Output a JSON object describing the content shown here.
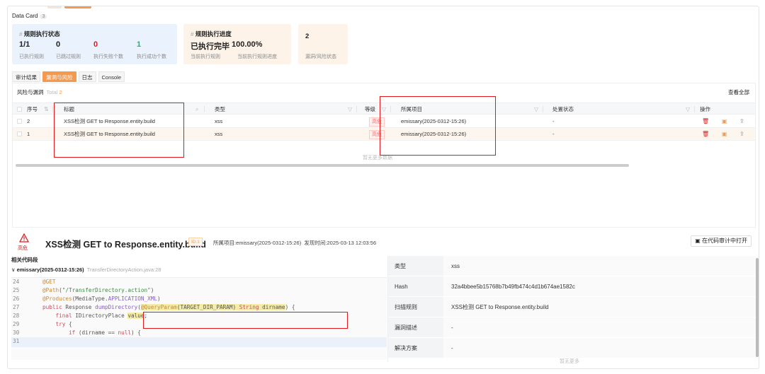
{
  "data_card": {
    "title": "Data Card",
    "count": "3",
    "cards": [
      {
        "title": "规则执行状态",
        "hash": "#",
        "values": [
          {
            "value": "1/1",
            "label": "已执行规则",
            "color": "#222222"
          },
          {
            "value": "0",
            "label": "已跳过规则",
            "color": "#222222"
          },
          {
            "value": "0",
            "label": "执行失败个数",
            "color": "#e0181c"
          },
          {
            "value": "1",
            "label": "执行成功个数",
            "color": "#3aa876"
          }
        ]
      },
      {
        "title": "规则执行进度",
        "hash": "#",
        "values": [
          {
            "value": "已执行完毕",
            "label": "当前执行规则"
          },
          {
            "value": "100.00%",
            "label": "当前执行规则进度"
          }
        ]
      },
      {
        "title": "2",
        "values": [
          {
            "value": "",
            "label": "漏洞/风险状态"
          }
        ]
      }
    ]
  },
  "tabs": [
    "审计结果",
    "漏洞与风险",
    "日志",
    "Console"
  ],
  "active_tab": "漏洞与风险",
  "risk_table": {
    "heading": "风险与漏洞",
    "total_label": "Total",
    "total": "2",
    "view_all": "查看全部",
    "columns": [
      "序号",
      "标题",
      "类型",
      "等级",
      "所属项目",
      "处置状态",
      "操作"
    ],
    "rows": [
      {
        "index": "2",
        "title": "XSS检测 GET to Response.entity.build",
        "type": "xss",
        "level": "高危",
        "project": "emissary(2025-0312-15:26)",
        "status": "-"
      },
      {
        "index": "1",
        "title": "XSS检测 GET to Response.entity.build",
        "type": "xss",
        "level": "高危",
        "project": "emissary(2025-0312-15:26)",
        "status": "-"
      }
    ],
    "no_more": "暂无更多数据"
  },
  "detail": {
    "severity": "高危",
    "title": "XSS检测 GET to Response.entity.build",
    "id": "ID:1",
    "project": "所属项目:emissary(2025-0312-15:26)",
    "found_time": "发现时间:2025-03-13 12:03:56",
    "open_button": "在代码审计中打开"
  },
  "code": {
    "heading": "相关代码段",
    "project": "emissary(2025-0312-15:26)",
    "file": "TransferDirectoryAction.java:28",
    "lines": [
      {
        "n": "24"
      },
      {
        "n": "25"
      },
      {
        "n": "26"
      },
      {
        "n": "27"
      },
      {
        "n": "28"
      },
      {
        "n": "29"
      },
      {
        "n": "30"
      },
      {
        "n": "31"
      }
    ]
  },
  "properties": {
    "rows": [
      {
        "key": "类型",
        "value": "xss"
      },
      {
        "key": "Hash",
        "value": "32a4bbee5b15768b7b49fb474c4d1b674ae1582c"
      },
      {
        "key": "扫描规则",
        "value": "XSS检测 GET to Response.entity.build"
      },
      {
        "key": "漏洞描述",
        "value": "-"
      },
      {
        "key": "解决方案",
        "value": "-"
      }
    ],
    "no_more": "暂无更多"
  },
  "colors": {
    "accent": "#f39a4f",
    "danger": "#e0181c",
    "success": "#3aa876",
    "highlight_box": "#e0181c"
  }
}
